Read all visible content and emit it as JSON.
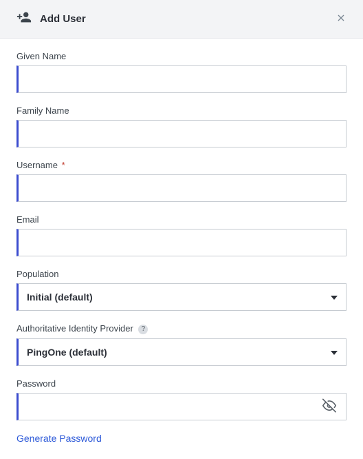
{
  "header": {
    "title": "Add User"
  },
  "fields": {
    "given_name": {
      "label": "Given Name",
      "value": ""
    },
    "family_name": {
      "label": "Family Name",
      "value": ""
    },
    "username": {
      "label": "Username",
      "value": "",
      "required_mark": "*"
    },
    "email": {
      "label": "Email",
      "value": ""
    },
    "population": {
      "label": "Population",
      "selected": "Initial (default)"
    },
    "identity_provider": {
      "label": "Authoritative Identity Provider",
      "selected": "PingOne (default)",
      "help": "?"
    },
    "password": {
      "label": "Password",
      "value": ""
    }
  },
  "actions": {
    "generate_password": "Generate Password"
  }
}
